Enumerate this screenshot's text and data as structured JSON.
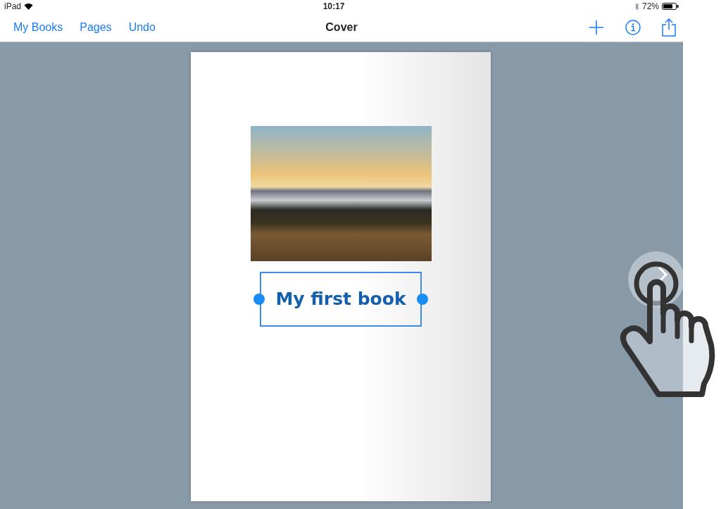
{
  "status_bar": {
    "device": "iPad",
    "time": "10:17",
    "battery": "72%"
  },
  "nav_bar": {
    "left_buttons": [
      "My Books",
      "Pages",
      "Undo"
    ],
    "title": "Cover"
  },
  "page": {
    "title_text": "My first book",
    "title_selected": true
  }
}
